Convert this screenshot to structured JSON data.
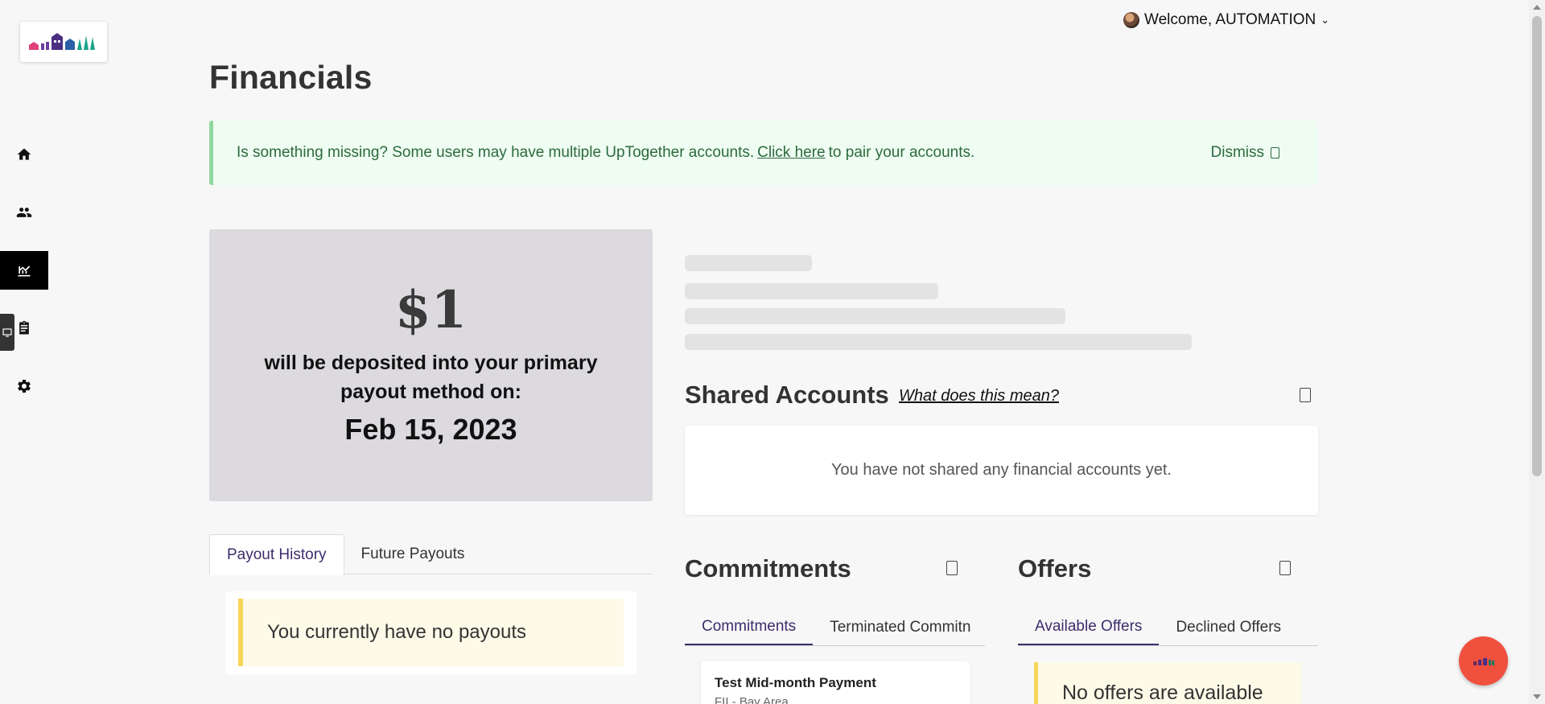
{
  "header": {
    "welcome": "Welcome, AUTOMATION",
    "logo_icon": "uptogether-logo-icon"
  },
  "sidebar": {
    "items": [
      {
        "icon": "home-icon",
        "label": "Home"
      },
      {
        "icon": "people-icon",
        "label": "Community"
      },
      {
        "icon": "financials-icon",
        "label": "Financials"
      },
      {
        "icon": "clipboard-icon",
        "label": "Tasks"
      },
      {
        "icon": "gear-icon",
        "label": "Settings"
      }
    ],
    "active_index": 2
  },
  "page": {
    "title": "Financials"
  },
  "alert": {
    "text_before": "Is something missing? Some users may have multiple UpTogether accounts.",
    "link": "Click here",
    "text_after": "to pair your accounts.",
    "dismiss": "Dismiss"
  },
  "deposit": {
    "amount": "$1",
    "text_line1": "will be deposited into your primary",
    "text_line2": "payout method on:",
    "date": "Feb 15, 2023"
  },
  "payouts": {
    "tabs": [
      "Payout History",
      "Future Payouts"
    ],
    "active_tab": "Payout History",
    "empty_message": "You currently have no payouts"
  },
  "shared_accounts": {
    "title": "Shared Accounts",
    "help_link": "What does this mean?",
    "empty_message": "You have not shared any financial accounts yet."
  },
  "commitments": {
    "title": "Commitments",
    "tabs": [
      "Commitments",
      "Terminated Commitn"
    ],
    "active_tab": "Commitments",
    "items": [
      {
        "title": "Test Mid-month Payment",
        "subtitle": "FII - Bay Area"
      }
    ]
  },
  "offers": {
    "title": "Offers",
    "tabs": [
      "Available Offers",
      "Declined Offers"
    ],
    "active_tab": "Available Offers",
    "empty_message": "No offers are available"
  },
  "colors": {
    "accent": "#3d2d6b",
    "alert_bg": "#eefcf1",
    "alert_border": "#8fd8a0",
    "deposit_bg": "#dcdadf",
    "notice_border": "#f6d65a",
    "fab": "#f0503e"
  }
}
